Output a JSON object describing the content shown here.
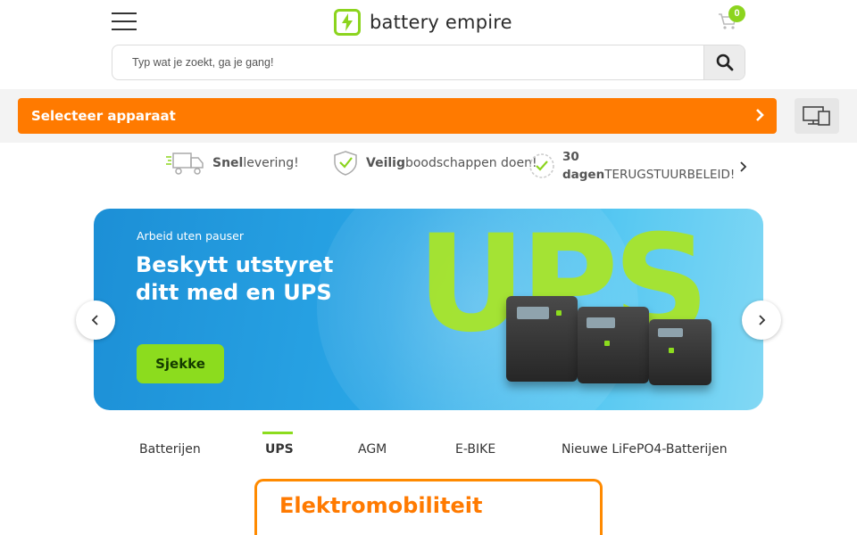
{
  "header": {
    "logo_text": "battery empire",
    "cart_count": "0"
  },
  "search": {
    "placeholder": "Typ wat je zoekt, ga je gang!"
  },
  "device_selector": {
    "label": "Selecteer apparaat"
  },
  "usps": [
    {
      "bold": "Snel",
      "text": "levering!"
    },
    {
      "bold": "Veilig",
      "text": "boodschappen doen!"
    },
    {
      "bold_line1": "30",
      "bold_line2": "dagen",
      "text": "TERUGSTUURBELEID!"
    }
  ],
  "banner": {
    "kicker": "Arbeid uten pauser",
    "title": "Beskytt utstyret ditt med en UPS",
    "cta": "Sjekke",
    "big_text": "UPS"
  },
  "tabs": [
    {
      "label": "Batterijen",
      "active": false
    },
    {
      "label": "UPS",
      "active": true
    },
    {
      "label": "AGM",
      "active": false
    },
    {
      "label": "E-BIKE",
      "active": false
    },
    {
      "label": "Nieuwe LiFePO4-Batterijen",
      "active": false
    }
  ],
  "section": {
    "title": "Elektromobiliteit"
  },
  "colors": {
    "accent_orange": "#ff7a00",
    "brand_green": "#8cd41e"
  }
}
